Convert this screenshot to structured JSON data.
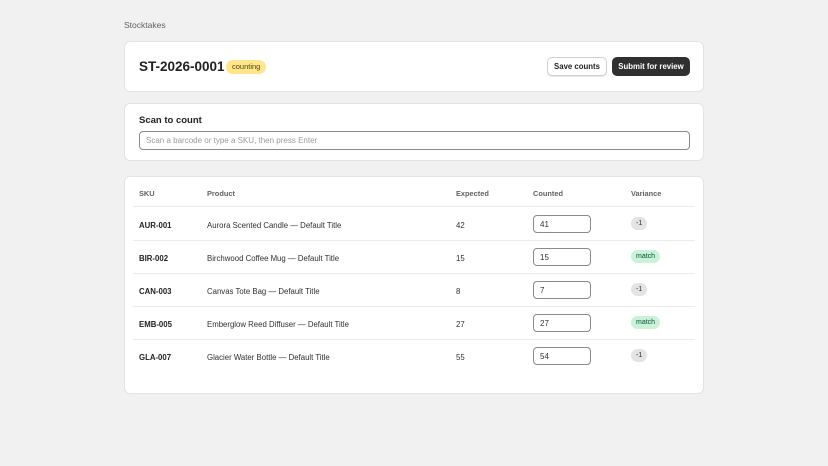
{
  "breadcrumb": "Stocktakes",
  "header": {
    "title": "ST-2026-0001",
    "status": "counting",
    "save_label": "Save counts",
    "submit_label": "Submit for review"
  },
  "scan": {
    "title": "Scan to count",
    "placeholder": "Scan a barcode or type a SKU, then press Enter",
    "value": ""
  },
  "table": {
    "columns": [
      "SKU",
      "Product",
      "Expected",
      "Counted",
      "Variance"
    ],
    "rows": [
      {
        "sku": "AUR-001",
        "product": "Aurora Scented Candle — Default Title",
        "expected": "42",
        "counted": "41",
        "variance": "-1",
        "variance_type": "neg"
      },
      {
        "sku": "BIR-002",
        "product": "Birchwood Coffee Mug — Default Title",
        "expected": "15",
        "counted": "15",
        "variance": "match",
        "variance_type": "match"
      },
      {
        "sku": "CAN-003",
        "product": "Canvas Tote Bag — Default Title",
        "expected": "8",
        "counted": "7",
        "variance": "-1",
        "variance_type": "neg"
      },
      {
        "sku": "EMB-005",
        "product": "Emberglow Reed Diffuser — Default Title",
        "expected": "27",
        "counted": "27",
        "variance": "match",
        "variance_type": "match"
      },
      {
        "sku": "GLA-007",
        "product": "Glacier Water Bottle — Default Title",
        "expected": "55",
        "counted": "54",
        "variance": "-1",
        "variance_type": "neg"
      }
    ]
  },
  "colors": {
    "background": "#f1f1f1",
    "primary_button": "#303030",
    "status_badge": "#ffe58c",
    "match_badge": "#c9f2d9",
    "negative_badge": "#e3e3e3"
  }
}
